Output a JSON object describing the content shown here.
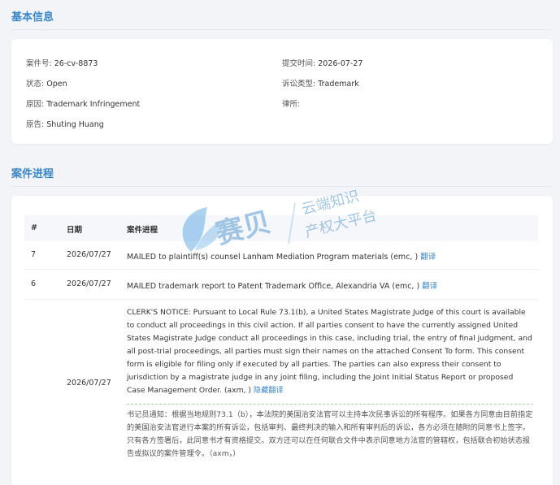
{
  "basic_info": {
    "title": "基本信息",
    "case_no_label": "案件号:",
    "case_no": "26-cv-8873",
    "filed_label": "提交时间:",
    "filed": "2026-07-27",
    "status_label": "状态:",
    "status": "Open",
    "type_label": "诉讼类型:",
    "type": "Trademark",
    "cause_label": "原因:",
    "cause": "Trademark Infringement",
    "lawyer_label": "律所:",
    "lawyer": "",
    "plaintiff_label": "原告:",
    "plaintiff": "Shuting Huang"
  },
  "progress": {
    "title": "案件进程",
    "headers": {
      "num": "#",
      "date": "日期",
      "event": "案件进程"
    },
    "rows": [
      {
        "num": "7",
        "date": "2026/07/27",
        "text": "MAILED to plaintiff(s) counsel Lanham Mediation Program materials (emc, )",
        "action": "翻译"
      },
      {
        "num": "6",
        "date": "2026/07/27",
        "text": "MAILED trademark report to Patent Trademark Office, Alexandria VA (emc, )",
        "action": "翻译"
      },
      {
        "num": "",
        "date": "2026/07/27",
        "text": "CLERK'S NOTICE: Pursuant to Local Rule 73.1(b), a United States Magistrate Judge of this court is available to conduct all proceedings in this civil action. If all parties consent to have the currently assigned United States Magistrate Judge conduct all proceedings in this case, including trial, the entry of final judgment, and all post-trial proceedings, all parties must sign their names on the attached Consent To form. This consent form is eligible for filing only if executed by all parties. The parties can also express their consent to jurisdiction by a magistrate judge in any joint filing, including the Joint Initial Status Report or proposed Case Management Order. (axm, )",
        "action": "隐藏翻译",
        "translation": "书记员通知：根据当地规则73.1（b），本法院的美国治安法官可以主持本次民事诉讼的所有程序。如果各方同意由目前指定的美国治安法官进行本案的所有诉讼，包括审判、最终判决的输入和所有审判后的诉讼，各方必须在随附的同意书上签字。只有各方签署后，此同意书才有资格提交。双方还可以在任何联合文件中表示同意地方法官的管辖权，包括联合初始状态报告或拟议的案件管理令。（axm，）"
      }
    ]
  },
  "watermark": {
    "brand": "赛贝",
    "line1": "云端知识",
    "line2": "产权大平台",
    "icon": "leaf-logo-icon"
  },
  "colors": {
    "accent": "#3a87c8",
    "bg": "#f2f4f7",
    "divider_dashed": "#9fd49a"
  }
}
